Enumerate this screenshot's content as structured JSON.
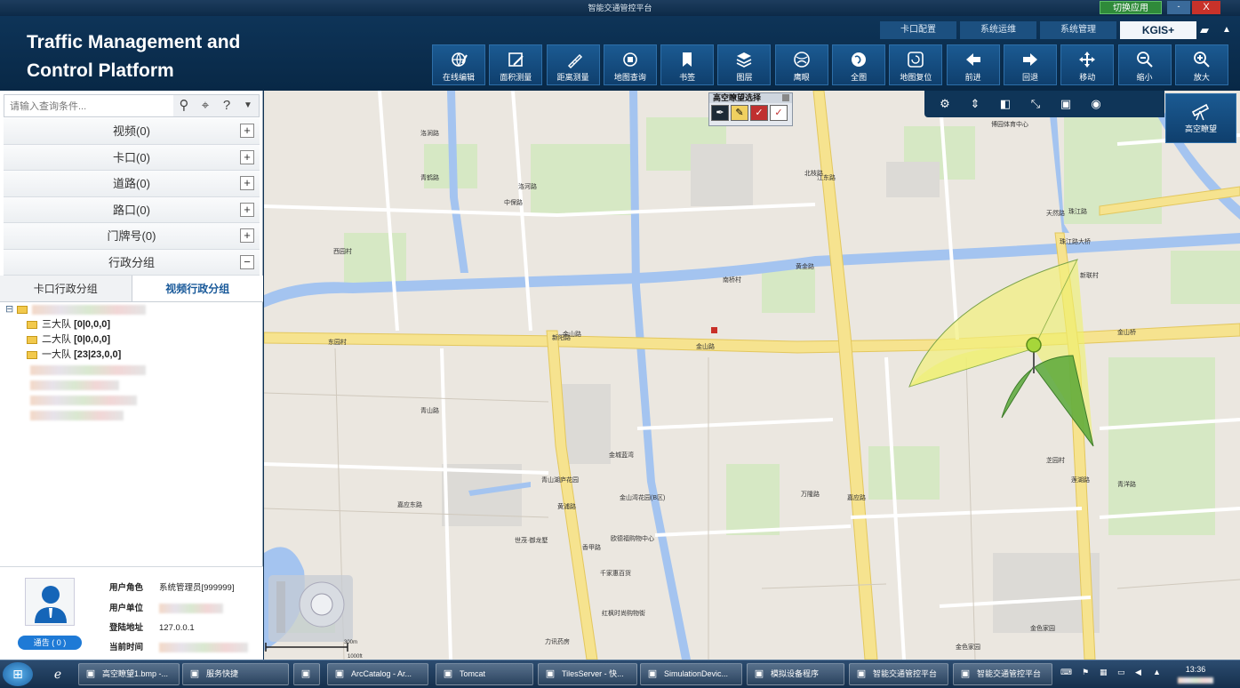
{
  "window": {
    "title": "智能交通管控平台",
    "switch_app": "切换应用",
    "minimize": "-",
    "close": "X"
  },
  "app": {
    "title_line1": "Traffic Management and",
    "title_line2": "Control Platform"
  },
  "tabs": [
    {
      "label": "卡口配置"
    },
    {
      "label": "系统运维"
    },
    {
      "label": "系统管理"
    },
    {
      "label": "KGIS+"
    }
  ],
  "toolbar": [
    {
      "label": "在线编辑",
      "icon": "globe-edit-icon"
    },
    {
      "label": "面积测量",
      "icon": "area-measure-icon"
    },
    {
      "label": "距离测量",
      "icon": "ruler-icon"
    },
    {
      "label": "地图查询",
      "icon": "map-query-icon"
    },
    {
      "label": "书签",
      "icon": "bookmark-icon"
    },
    {
      "label": "图层",
      "icon": "layers-icon"
    },
    {
      "label": "鹰眼",
      "icon": "eagle-eye-icon"
    },
    {
      "label": "全图",
      "icon": "full-map-icon"
    },
    {
      "label": "地图复位",
      "icon": "map-reset-icon"
    },
    {
      "label": "前进",
      "icon": "arrow-left-icon"
    },
    {
      "label": "回退",
      "icon": "arrow-right-icon"
    },
    {
      "label": "移动",
      "icon": "move-icon"
    },
    {
      "label": "缩小",
      "icon": "zoom-out-icon"
    },
    {
      "label": "放大",
      "icon": "zoom-in-icon"
    }
  ],
  "high_obs": {
    "label": "高空瞭望"
  },
  "obs_select": {
    "title": "高空瞭望选择"
  },
  "search": {
    "placeholder": "请输入查询条件..."
  },
  "categories": [
    {
      "label": "视频(0)",
      "toggle": "+"
    },
    {
      "label": "卡口(0)",
      "toggle": "+"
    },
    {
      "label": "道路(0)",
      "toggle": "+"
    },
    {
      "label": "路口(0)",
      "toggle": "+"
    },
    {
      "label": "门牌号(0)",
      "toggle": "+"
    },
    {
      "label": "行政分组",
      "toggle": "−"
    }
  ],
  "subtabs": [
    {
      "label": "卡口行政分组"
    },
    {
      "label": "视频行政分组"
    }
  ],
  "tree": {
    "root_expander": "⊟",
    "items": [
      {
        "label": "三大队",
        "counts": "[0|0,0,0]"
      },
      {
        "label": "二大队",
        "counts": "[0|0,0,0]"
      },
      {
        "label": "一大队",
        "counts": "[23|23,0,0]"
      }
    ]
  },
  "user": {
    "warn_label": "通告 ( 0 )",
    "role_key": "用户角色",
    "role_val": "系统管理员[999999]",
    "unit_key": "用户单位",
    "ip_key": "登陆地址",
    "ip_val": "127.0.0.1",
    "time_key": "当前时间"
  },
  "map": {
    "scale_top": "300m",
    "scale_bottom": "1000ft",
    "labels": [
      "博园体育中心",
      "金城蓝湾",
      "青山湖庐花园",
      "金山湾花园(B区)",
      "世茂·御龙墅",
      "欧德福购物中心",
      "千家惠百货",
      "红枫时尚购物街",
      "力讯药房",
      "金色家园",
      "金色家园",
      "金山路",
      "金山路",
      "金山桥",
      "南桥村",
      "西园村",
      "东园村",
      "芝园村",
      "中保路",
      "青山路",
      "万隆路",
      "嘉应路",
      "珠江路",
      "珠江路大桥",
      "新联村",
      "天然路",
      "青鹤路",
      "洛涧路",
      "洛河路",
      "新阳路",
      "黄浦路",
      "香甲路",
      "北枝路",
      "江东路",
      "莲湖路",
      "嘉应东路",
      "青洋路",
      "黄金路"
    ]
  },
  "taskbar": {
    "start": "⊞",
    "tasks": [
      {
        "label": "高空瞭望1.bmp -..."
      },
      {
        "label": "服务快捷"
      },
      {
        "label": ""
      },
      {
        "label": "ArcCatalog - Ar..."
      },
      {
        "label": "Tomcat"
      },
      {
        "label": "TilesServer - 快..."
      },
      {
        "label": "SimulationDevic..."
      },
      {
        "label": "模拟设备程序"
      },
      {
        "label": "智能交通管控平台"
      },
      {
        "label": "智能交通管控平台"
      }
    ],
    "clock": "13:36"
  }
}
